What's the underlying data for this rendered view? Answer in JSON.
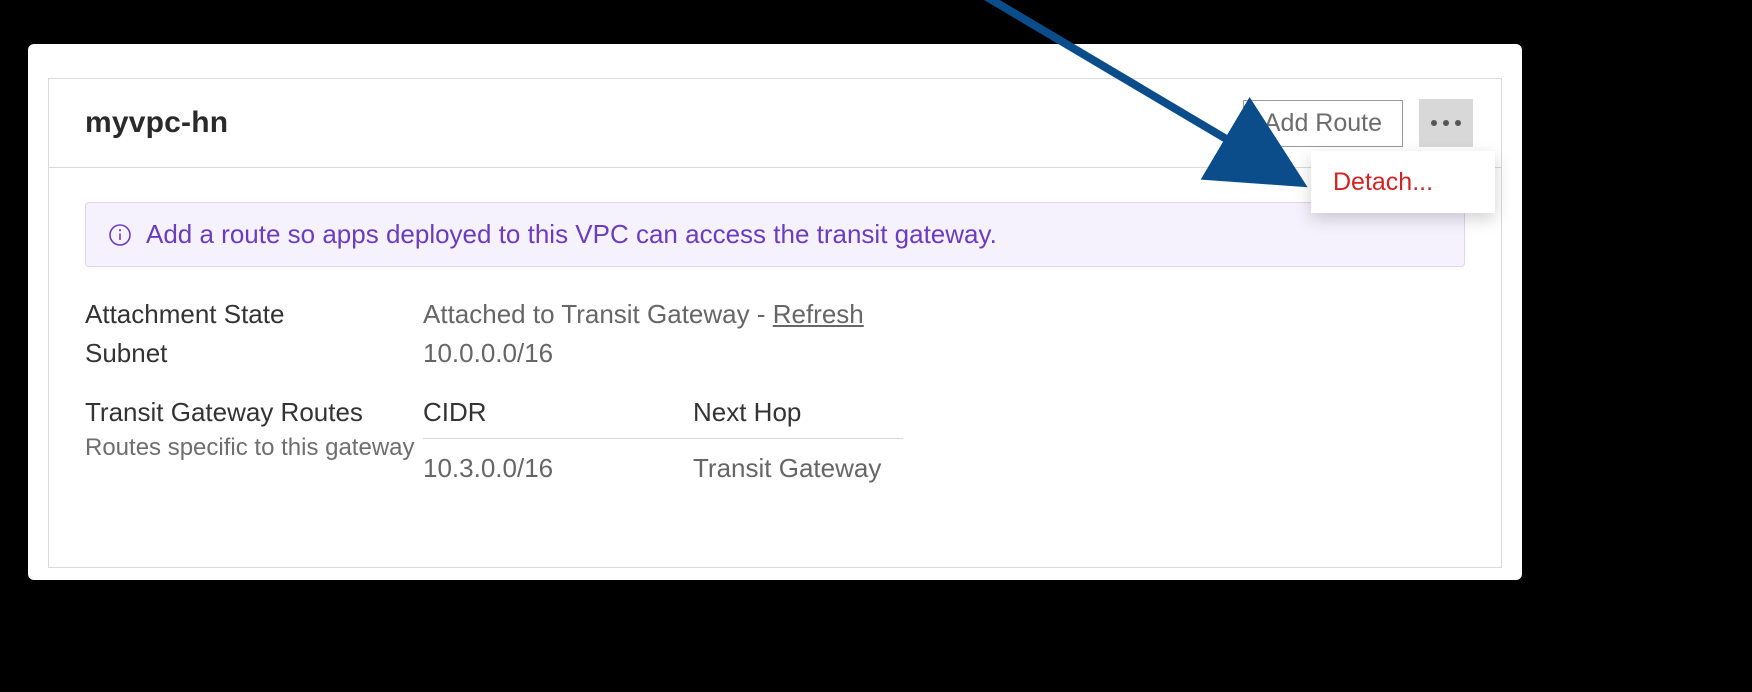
{
  "panel": {
    "title": "myvpc-hn",
    "add_route_label": "Add Route"
  },
  "menu": {
    "detach_label": "Detach..."
  },
  "alert": {
    "text": "Add a route so apps deployed to this VPC can access the transit gateway."
  },
  "details": {
    "attachment_state_label": "Attachment State",
    "attachment_state_value": "Attached to Transit Gateway - ",
    "refresh_label": "Refresh",
    "subnet_label": "Subnet",
    "subnet_value": "10.0.0.0/16"
  },
  "routes": {
    "section_label": "Transit Gateway Routes",
    "section_sublabel": "Routes specific to this gateway",
    "columns": {
      "cidr": "CIDR",
      "next_hop": "Next Hop"
    },
    "rows": [
      {
        "cidr": "10.3.0.0/16",
        "next_hop": "Transit Gateway"
      }
    ]
  }
}
